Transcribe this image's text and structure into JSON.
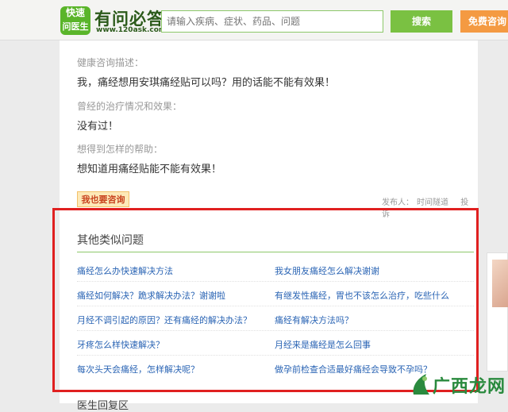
{
  "header": {
    "logo_line1": "快速",
    "logo_line2": "问医生",
    "brand": "有问必答",
    "url": "www.120ask.com",
    "search_placeholder": "请输入疾病、症状、药品、问题",
    "search_button": "搜索",
    "consult_button": "免费咨询"
  },
  "question": {
    "desc_label": "健康咨询描述：",
    "desc_text": "我，痛经想用安琪痛经贴可以吗？用的话能不能有效果！",
    "treat_label": "曾经的治疗情况和效果：",
    "treat_text": "没有过！",
    "help_label": "想得到怎样的帮助：",
    "help_text": "想知道用痛经贴能不能有效果！",
    "ask_button": "我也要咨询",
    "publisher_label": "发布人：",
    "publisher_name": "时间隧道",
    "report": "投诉"
  },
  "similar": {
    "title": "其他类似问题",
    "rows": [
      {
        "left": "痛经怎么办快速解决方法",
        "right": "我女朋友痛经怎么解决谢谢"
      },
      {
        "left": "痛经如何解决？跪求解决办法？谢谢啦",
        "right": "有继发性痛经，胃也不该怎么治疗，吃些什么"
      },
      {
        "left": "月经不调引起的原因？还有痛经的解决办法？",
        "right": "痛经有解决方法吗？"
      },
      {
        "left": "牙疼怎么样快速解决？",
        "right": "月经来是痛经是怎么回事"
      },
      {
        "left": "每次头天会痛经，怎样解决呢？",
        "right": "做孕前检查合适最好痛经会导致不孕吗？"
      }
    ]
  },
  "doctor_reply": "医生回复区",
  "watermark": "广西龙网",
  "colors": {
    "brand_green": "#5ab52a",
    "search_green": "#7ac142",
    "consult_orange": "#f49a42",
    "link_blue": "#2a64b4",
    "highlight_red": "#e02020"
  }
}
